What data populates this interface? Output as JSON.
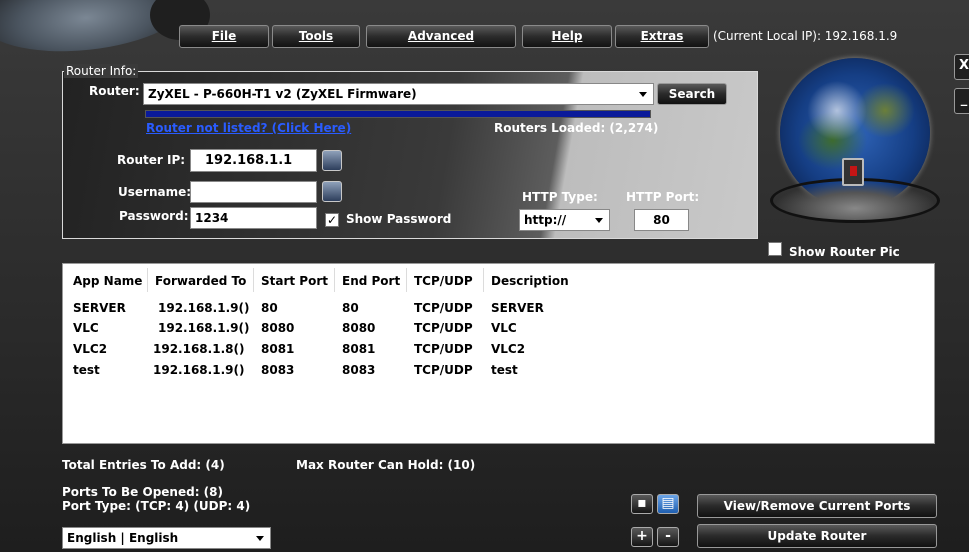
{
  "menu": {
    "file": "File",
    "tools": "Tools",
    "advanced": "Advanced",
    "help": "Help",
    "extras": "Extras",
    "local_ip": "(Current Local IP): 192.168.1.9"
  },
  "window": {
    "close": "X",
    "minimize": "_"
  },
  "router_info": {
    "legend": "Router Info:",
    "router_label": "Router:",
    "router_value": "ZyXEL - P-660H-T1 v2 (ZyXEL Firmware)",
    "search_button": "Search",
    "not_listed_link": "Router not listed? (Click Here)",
    "routers_loaded": "Routers Loaded: (2,274)",
    "router_ip_label": "Router IP:",
    "router_ip_value": "192.168.1.1",
    "username_label": "Username:",
    "username_value": "",
    "password_label": "Password:",
    "password_value": "1234",
    "show_password_label": "Show Password",
    "show_password_checked": true,
    "http_type_label": "HTTP Type:",
    "http_type_value": "http://",
    "http_port_label": "HTTP Port:",
    "http_port_value": "80",
    "load_progress": 1.0
  },
  "show_router_pic_label": "Show Router Pic",
  "show_router_pic_checked": false,
  "table": {
    "headers": [
      "App Name",
      "Forwarded To",
      "Start Port",
      "End Port",
      "TCP/UDP",
      "Description"
    ],
    "rows": [
      [
        "SERVER",
        "192.168.1.9()",
        "80",
        "80",
        "TCP/UDP",
        "SERVER"
      ],
      [
        "VLC",
        "192.168.1.9()",
        "8080",
        "8080",
        "TCP/UDP",
        "VLC"
      ],
      [
        "VLC2",
        "192.168.1.8()",
        "8081",
        "8081",
        "TCP/UDP",
        "VLC2"
      ],
      [
        "test",
        "192.168.1.9()",
        "8083",
        "8083",
        "TCP/UDP",
        "test"
      ]
    ]
  },
  "footer": {
    "total_entries": "Total Entries To Add: (4)",
    "max_router": "Max Router Can Hold: (10)",
    "ports_opened": "Ports To Be Opened: (8)",
    "port_type": "Port Type: (TCP: 4) (UDP: 4)",
    "language": "English | English",
    "view_remove_button": "View/Remove Current Ports",
    "update_button": "Update Router",
    "plus": "+",
    "minus": "-"
  }
}
